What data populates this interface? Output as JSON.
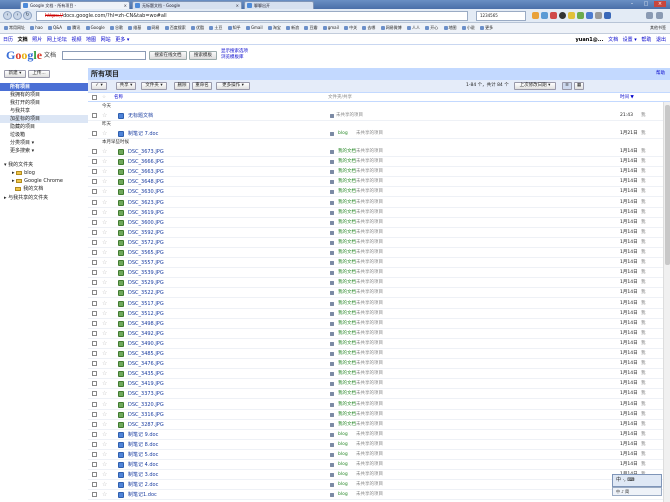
{
  "browser": {
    "tabs": [
      {
        "label": "Google 文档 - 所有项目 -",
        "active": true
      },
      {
        "label": "无标题文档 - Google",
        "active": false
      },
      {
        "label": "聊聊出开",
        "active": false
      }
    ],
    "url_scheme": "https://",
    "url_rest": "docs.google.com/?hl=zh-CN&tab=wo#all",
    "right_box": "1234565",
    "bookmarks": [
      "常用网址",
      "hao",
      "Q&A",
      "腾讯",
      "Google",
      "谷歌",
      "维基",
      "网易",
      "百度搜索",
      "优酷",
      "土豆",
      "知乎",
      "Gmail",
      "淘宝",
      "新浪",
      "豆瓣",
      "gmail",
      "中关",
      "去哪",
      "网易微博",
      "人人",
      "开心",
      "地图",
      "小说",
      "更多"
    ],
    "bookmarks_other": "其他书签"
  },
  "gbar": {
    "links": [
      "日历",
      "文档",
      "照片",
      "网上论坛",
      "视频",
      "地图",
      "网站",
      "更多 ▾"
    ],
    "current": "文档",
    "user": "yuan1@...",
    "user_links": [
      "文档",
      "设置 ▾",
      "帮助",
      "退出"
    ]
  },
  "header": {
    "logo_letters": [
      "G",
      "o",
      "o",
      "g",
      "l",
      "e"
    ],
    "product": "文档",
    "search_button": "搜索在线文档",
    "template_button": "搜索模板",
    "links": [
      "显示搜索选项",
      "浏览模板库"
    ]
  },
  "sidebar": {
    "new_button": "新建 ▾",
    "upload_button": "上传...",
    "items": [
      {
        "label": "所有项目",
        "selected": true
      },
      {
        "label": "我拥有的项目",
        "selected": false
      },
      {
        "label": "我打开的项目",
        "selected": false
      },
      {
        "label": "与我共享",
        "selected": false
      },
      {
        "label": "加星标的项目",
        "selected": false,
        "highlight": true
      },
      {
        "label": "隐藏的项目",
        "selected": false
      },
      {
        "label": "垃圾箱",
        "selected": false
      },
      {
        "label": "分类项目 ▾",
        "selected": false
      },
      {
        "label": "更多搜索 ▾",
        "selected": false
      }
    ],
    "folders_title": "我的文件夹",
    "folders": [
      "blog",
      "Google Chrome",
      "我的文档"
    ],
    "shared_folders": "与我共享的文件夹"
  },
  "main": {
    "title": "所有项目",
    "help": "帮助",
    "toolbar": {
      "select": "✓ ▾",
      "share": "共享 ▾",
      "folders": "文件夹 ▾",
      "delete": "删除",
      "rename": "重命名",
      "more": "更多操作 ▾",
      "count": "1-84 个，共计 84 个",
      "sort": "上次修改日期 ▾"
    },
    "columns": {
      "name": "名称",
      "folder": "文件夹/共享",
      "date": "时间 ▼"
    },
    "groups": {
      "today": "今天",
      "yesterday": "昨天",
      "older": "本月早些时候"
    },
    "rows": [
      {
        "name": "无标题文档",
        "type": "doc",
        "folder": "",
        "share": "未共享的项目",
        "date": "21:43",
        "who": "我"
      },
      {
        "name": "制笔记 7.doc",
        "type": "doc",
        "folder": "blog",
        "share": "未共享的项目",
        "date": "1月21日",
        "who": "我"
      },
      {
        "name": "DSC_3673.JPG",
        "type": "img",
        "folder": "我的文档",
        "share": "未共享的项目",
        "date": "1月14日",
        "who": "我"
      },
      {
        "name": "DSC_3666.JPG",
        "type": "img",
        "folder": "我的文档",
        "share": "未共享的项目",
        "date": "1月14日",
        "who": "我"
      },
      {
        "name": "DSC_3663.JPG",
        "type": "img",
        "folder": "我的文档",
        "share": "未共享的项目",
        "date": "1月14日",
        "who": "我"
      },
      {
        "name": "DSC_3648.JPG",
        "type": "img",
        "folder": "我的文档",
        "share": "未共享的项目",
        "date": "1月14日",
        "who": "我"
      },
      {
        "name": "DSC_3630.JPG",
        "type": "img",
        "folder": "我的文档",
        "share": "未共享的项目",
        "date": "1月14日",
        "who": "我"
      },
      {
        "name": "DSC_3623.JPG",
        "type": "img",
        "folder": "我的文档",
        "share": "未共享的项目",
        "date": "1月14日",
        "who": "我"
      },
      {
        "name": "DSC_3619.JPG",
        "type": "img",
        "folder": "我的文档",
        "share": "未共享的项目",
        "date": "1月14日",
        "who": "我"
      },
      {
        "name": "DSC_3600.JPG",
        "type": "img",
        "folder": "我的文档",
        "share": "未共享的项目",
        "date": "1月14日",
        "who": "我"
      },
      {
        "name": "DSC_3592.JPG",
        "type": "img",
        "folder": "我的文档",
        "share": "未共享的项目",
        "date": "1月14日",
        "who": "我"
      },
      {
        "name": "DSC_3572.JPG",
        "type": "img",
        "folder": "我的文档",
        "share": "未共享的项目",
        "date": "1月14日",
        "who": "我"
      },
      {
        "name": "DSC_3565.JPG",
        "type": "img",
        "folder": "我的文档",
        "share": "未共享的项目",
        "date": "1月14日",
        "who": "我"
      },
      {
        "name": "DSC_3557.JPG",
        "type": "img",
        "folder": "我的文档",
        "share": "未共享的项目",
        "date": "1月14日",
        "who": "我"
      },
      {
        "name": "DSC_3539.JPG",
        "type": "img",
        "folder": "我的文档",
        "share": "未共享的项目",
        "date": "1月14日",
        "who": "我"
      },
      {
        "name": "DSC_3529.JPG",
        "type": "img",
        "folder": "我的文档",
        "share": "未共享的项目",
        "date": "1月14日",
        "who": "我"
      },
      {
        "name": "DSC_3522.JPG",
        "type": "img",
        "folder": "我的文档",
        "share": "未共享的项目",
        "date": "1月14日",
        "who": "我"
      },
      {
        "name": "DSC_3517.JPG",
        "type": "img",
        "folder": "我的文档",
        "share": "未共享的项目",
        "date": "1月14日",
        "who": "我"
      },
      {
        "name": "DSC_3512.JPG",
        "type": "img",
        "folder": "我的文档",
        "share": "未共享的项目",
        "date": "1月14日",
        "who": "我"
      },
      {
        "name": "DSC_3498.JPG",
        "type": "img",
        "folder": "我的文档",
        "share": "未共享的项目",
        "date": "1月14日",
        "who": "我"
      },
      {
        "name": "DSC_3492.JPG",
        "type": "img",
        "folder": "我的文档",
        "share": "未共享的项目",
        "date": "1月14日",
        "who": "我"
      },
      {
        "name": "DSC_3490.JPG",
        "type": "img",
        "folder": "我的文档",
        "share": "未共享的项目",
        "date": "1月14日",
        "who": "我"
      },
      {
        "name": "DSC_3485.JPG",
        "type": "img",
        "folder": "我的文档",
        "share": "未共享的项目",
        "date": "1月14日",
        "who": "我"
      },
      {
        "name": "DSC_3476.JPG",
        "type": "img",
        "folder": "我的文档",
        "share": "未共享的项目",
        "date": "1月14日",
        "who": "我"
      },
      {
        "name": "DSC_3435.JPG",
        "type": "img",
        "folder": "我的文档",
        "share": "未共享的项目",
        "date": "1月14日",
        "who": "我"
      },
      {
        "name": "DSC_3419.JPG",
        "type": "img",
        "folder": "我的文档",
        "share": "未共享的项目",
        "date": "1月14日",
        "who": "我"
      },
      {
        "name": "DSC_3373.JPG",
        "type": "img",
        "folder": "我的文档",
        "share": "未共享的项目",
        "date": "1月14日",
        "who": "我"
      },
      {
        "name": "DSC_3320.JPG",
        "type": "img",
        "folder": "我的文档",
        "share": "未共享的项目",
        "date": "1月14日",
        "who": "我"
      },
      {
        "name": "DSC_3316.JPG",
        "type": "img",
        "folder": "我的文档",
        "share": "未共享的项目",
        "date": "1月14日",
        "who": "我"
      },
      {
        "name": "DSC_3287.JPG",
        "type": "img",
        "folder": "我的文档",
        "share": "未共享的项目",
        "date": "1月14日",
        "who": "我"
      },
      {
        "name": "制笔记 9.doc",
        "type": "doc",
        "folder": "blog",
        "share": "未共享的项目",
        "date": "1月14日",
        "who": "我"
      },
      {
        "name": "制笔记 8.doc",
        "type": "doc",
        "folder": "blog",
        "share": "未共享的项目",
        "date": "1月14日",
        "who": "我"
      },
      {
        "name": "制笔记 5.doc",
        "type": "doc",
        "folder": "blog",
        "share": "未共享的项目",
        "date": "1月14日",
        "who": "我"
      },
      {
        "name": "制笔记 4.doc",
        "type": "doc",
        "folder": "blog",
        "share": "未共享的项目",
        "date": "1月14日",
        "who": "我"
      },
      {
        "name": "制笔记 3.doc",
        "type": "doc",
        "folder": "blog",
        "share": "未共享的项目",
        "date": "1月14日",
        "who": "我"
      },
      {
        "name": "制笔记 2.doc",
        "type": "doc",
        "folder": "blog",
        "share": "未共享的项目",
        "date": "1月14日",
        "who": "我"
      },
      {
        "name": "制笔记1.doc",
        "type": "doc",
        "folder": "blog",
        "share": "未共享的项目",
        "date": "1月14日",
        "who": "我"
      }
    ]
  },
  "ime": {
    "label": "中 ·, ⌨",
    "sub": "中 ♪ 简"
  },
  "colors": {
    "accent": "#4a6fd5",
    "header": "#c3d9ff",
    "link": "#1a3da0",
    "folder_green": "#2a8a2a"
  }
}
